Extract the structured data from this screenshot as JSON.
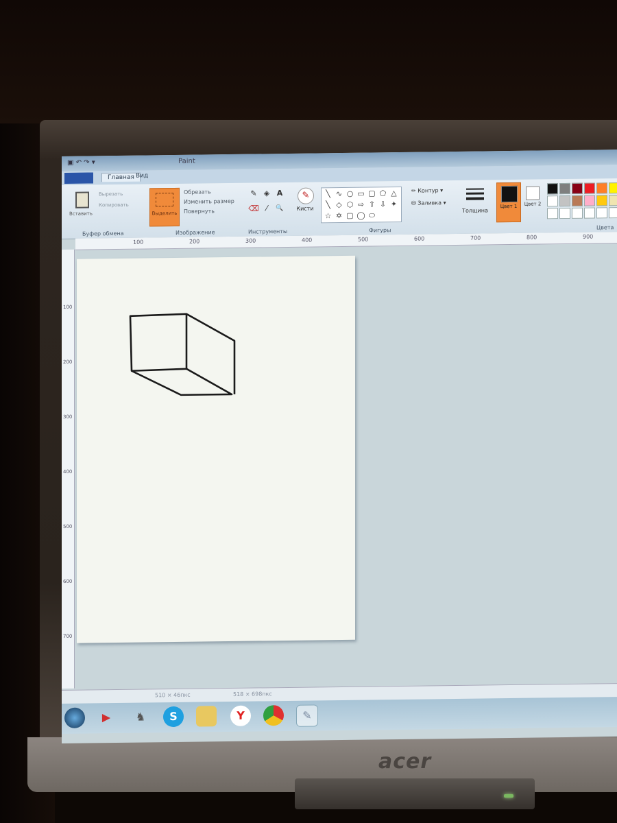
{
  "window": {
    "title": "Paint",
    "quick_access": "▣ ↶ ↷ ▾"
  },
  "ribbon": {
    "file_tab": "",
    "tabs": [
      "Главная",
      "Вид"
    ],
    "clipboard": {
      "paste_label": "Вставить",
      "cut_label": "Вырезать",
      "copy_label": "Копировать",
      "group": "Буфер обмена"
    },
    "image": {
      "select_label": "Выделить",
      "crop": "Обрезать",
      "resize": "Изменить размер",
      "rotate": "Повернуть",
      "group": "Изображение"
    },
    "tools": {
      "group": "Инструменты",
      "items": [
        "✎",
        "◈",
        "A",
        "⌫",
        "⁄",
        "🔍"
      ]
    },
    "brushes": {
      "label": "Кисти"
    },
    "shapes": {
      "group": "Фигуры",
      "outline": "Контур",
      "fill": "Заливка",
      "items": [
        "╲",
        "∿",
        "○",
        "▭",
        "▢",
        "⬠",
        "△",
        "╲",
        "◇",
        "⬡",
        "⇨",
        "⇧",
        "⇩",
        "✦",
        "☆",
        "✡",
        "▢",
        "◯",
        "⬭"
      ]
    },
    "thickness": {
      "label": "Толщина"
    },
    "color1": {
      "label": "Цвет 1",
      "value": "#111111"
    },
    "color2": {
      "label": "Цвет 2",
      "value": "#ffffff"
    },
    "colors_group": "Цвета",
    "palette": [
      "#111111",
      "#7f7f7f",
      "#880015",
      "#ed1c24",
      "#ff7f27",
      "#fff200",
      "#ffffff",
      "#c3c3c3",
      "#b97a57",
      "#ffaec9",
      "#ffc90e",
      "#efe4b0",
      "#ffffff",
      "#ffffff",
      "#ffffff",
      "#ffffff",
      "#ffffff",
      "#ffffff"
    ]
  },
  "rulers": {
    "horizontal": [
      "100",
      "200",
      "300",
      "400",
      "500",
      "600",
      "700",
      "800",
      "900"
    ],
    "vertical": [
      "100",
      "200",
      "300",
      "400",
      "500",
      "600",
      "700"
    ]
  },
  "status": {
    "cursor": "510 × 46пкс",
    "size": "518 × 698пкс"
  },
  "taskbar": {
    "items": [
      "start",
      "media-player",
      "game",
      "skype",
      "explorer",
      "yandex-browser",
      "chrome",
      "paint"
    ]
  }
}
